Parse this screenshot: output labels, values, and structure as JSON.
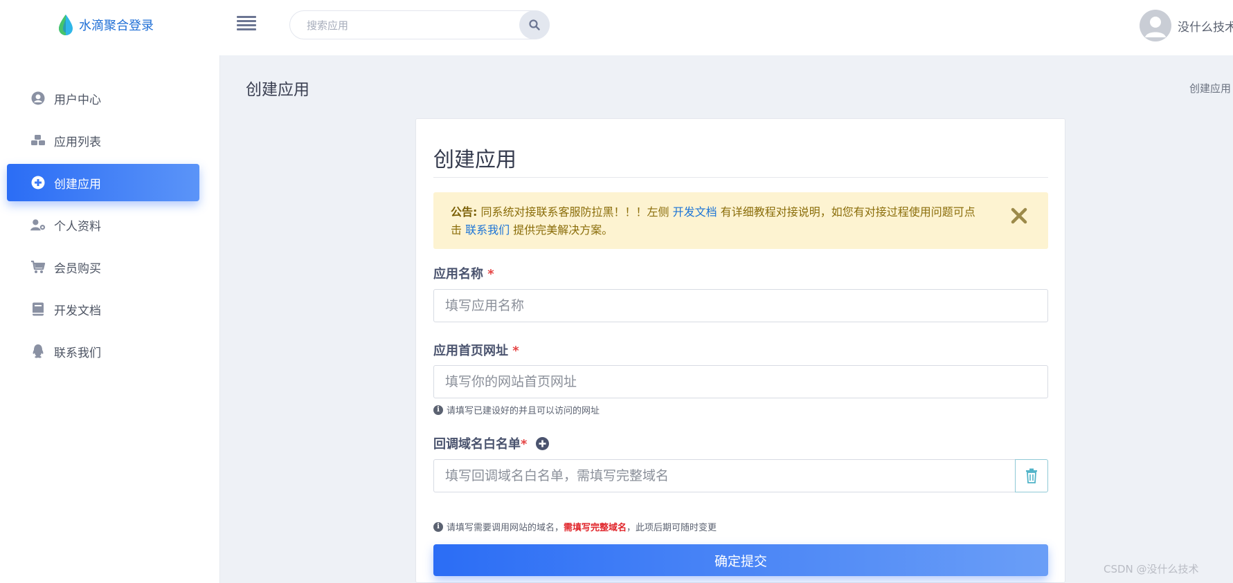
{
  "header": {
    "brand": "水滴聚合登录",
    "search_placeholder": "搜索应用",
    "user_name": "没什么技术"
  },
  "sidebar": {
    "items": [
      {
        "label": "用户中心",
        "icon": "user-circle-icon"
      },
      {
        "label": "应用列表",
        "icon": "cubes-icon"
      },
      {
        "label": "创建应用",
        "icon": "plus-circle-icon",
        "active": true
      },
      {
        "label": "个人资料",
        "icon": "user-cog-icon"
      },
      {
        "label": "会员购买",
        "icon": "cart-icon"
      },
      {
        "label": "开发文档",
        "icon": "book-icon"
      },
      {
        "label": "联系我们",
        "icon": "qq-icon"
      }
    ]
  },
  "page": {
    "title": "创建应用",
    "breadcrumb": "创建应用"
  },
  "card": {
    "title": "创建应用",
    "notice": {
      "prefix": "公告:",
      "text1": "同系统对接联系客服防拉黑！！！左侧",
      "link1": "开发文档",
      "text2": "有详细教程对接说明，如您有对接过程使用问题可点击",
      "link2": "联系我们",
      "text3": "提供完美解决方案。"
    },
    "app_name": {
      "label": "应用名称",
      "required": "*",
      "placeholder": "填写应用名称"
    },
    "homepage": {
      "label": "应用首页网址",
      "required": "*",
      "placeholder": "填写你的网站首页网址",
      "hint": "请填写已建设好的并且可以访问的网址"
    },
    "callback": {
      "label": "回调域名白名单",
      "required": "*",
      "placeholder": "填写回调域名白名单，需填写完整域名",
      "hint_pre": "请填写需要调用网站的域名，",
      "hint_red": "需填写完整域名",
      "hint_post": "，此项后期可随时变更"
    },
    "submit_label": "确定提交"
  },
  "watermark": "CSDN @没什么技术",
  "colors": {
    "accent": "#2b6df5",
    "notice_bg": "#fdf3d1",
    "required": "#e54343"
  }
}
